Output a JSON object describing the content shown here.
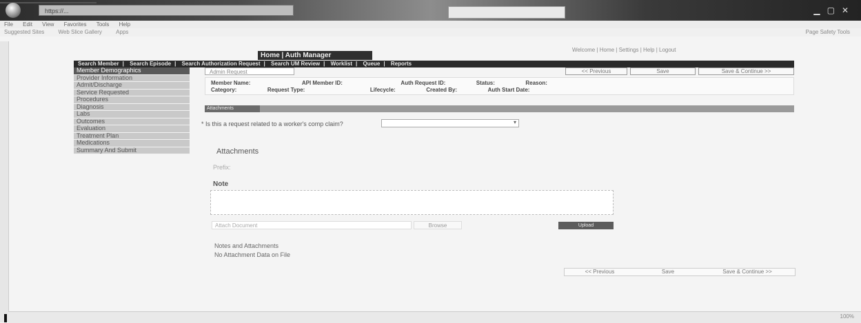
{
  "browser": {
    "address": "https://...",
    "menu": [
      "File",
      "Edit",
      "View",
      "Favorites",
      "Tools",
      "Help"
    ],
    "favorites": [
      "Suggested Sites",
      "Web Slice Gallery",
      "Apps"
    ],
    "right_tools": "Page  Safety  Tools",
    "zoom": "100%"
  },
  "app": {
    "title": "Home | Auth Manager",
    "top_links": "Welcome  |  Home  |  Settings  |  Help  |  Logout"
  },
  "nav": {
    "items": [
      "Search Member",
      "Search Episode",
      "Search Authorization Request",
      "Search UM Review",
      "Worklist",
      "Queue",
      "Reports"
    ]
  },
  "sidebar": {
    "items": [
      "Member Demographics",
      "Provider Information",
      "Admit/Discharge",
      "Service Requested",
      "Procedures",
      "Diagnosis",
      "Labs",
      "Outcomes",
      "Evaluation",
      "Treatment Plan",
      "Medications",
      "Summary And Submit"
    ],
    "active_index": 0
  },
  "tabs": {
    "active": "Admin Request",
    "previous": "<< Previous",
    "save": "Save",
    "save_continue": "Save & Continue >>"
  },
  "info": {
    "member_name_label": "Member Name:",
    "member_id_label": "API Member ID:",
    "auth_id_label": "Auth Request ID:",
    "status_label": "Status:",
    "reason_label": "Reason:",
    "category_label": "Category:",
    "type_label": "Request Type:",
    "lifecycle_label": "Lifecycle:",
    "created_label": "Created By:",
    "start_label": "Auth Start Date:"
  },
  "section": {
    "title": "Attachments"
  },
  "question": {
    "label": "* Is this a request related to a worker's comp claim?",
    "select_value": ""
  },
  "attachments": {
    "title": "Attachments",
    "prefix_label": "Prefix:",
    "note_label": "Note",
    "attach_placeholder": "Attach Document",
    "browse_label": "Browse",
    "upload_label": "Upload",
    "notes_line1": "Notes and Attachments",
    "notes_line2": "No Attachment Data on File"
  },
  "bottom": {
    "previous": "<< Previous",
    "save": "Save",
    "save_continue": "Save & Continue >>"
  }
}
